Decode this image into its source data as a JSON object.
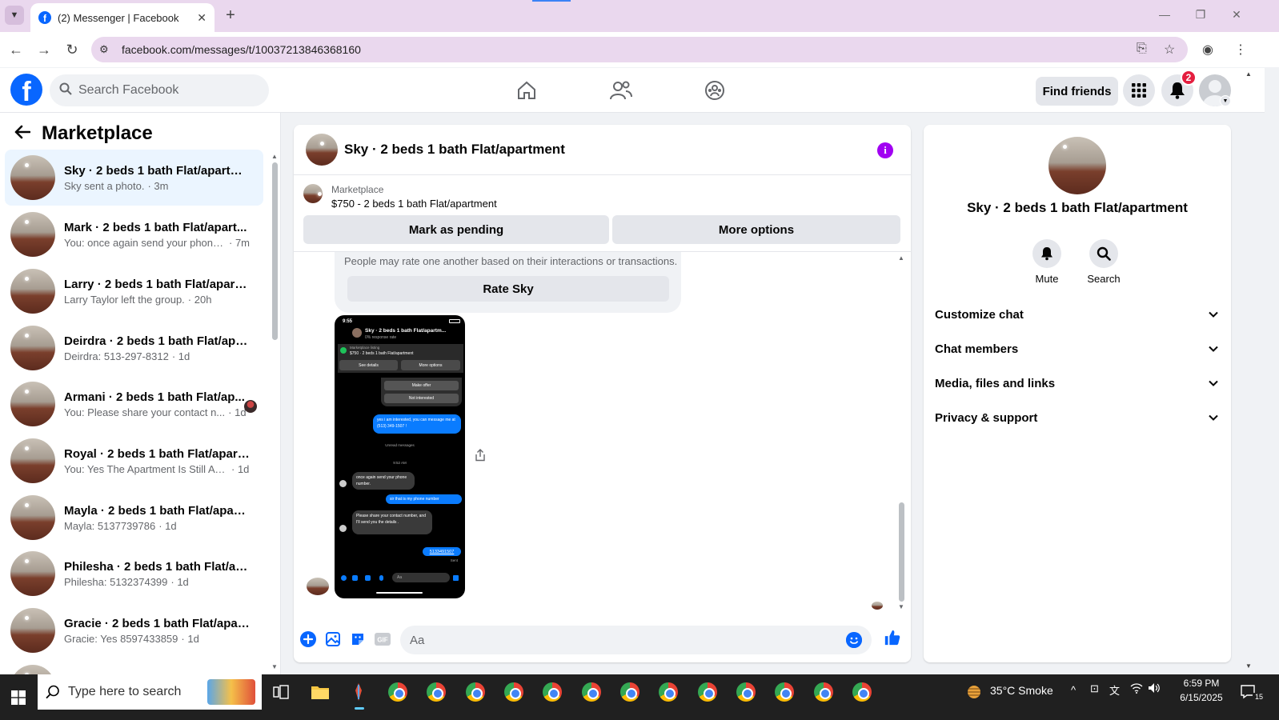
{
  "browser": {
    "tab_title": "(2) Messenger | Facebook",
    "url": "facebook.com/messages/t/10037213846368160"
  },
  "fb_header": {
    "search_placeholder": "Search Facebook",
    "find_friends_label": "Find friends",
    "notification_count": "2"
  },
  "sidebar": {
    "title": "Marketplace",
    "conversations": [
      {
        "name": "Sky · 2 beds 1 bath Flat/apartment",
        "preview": "Sky sent a photo.",
        "time": "· 3m",
        "active": true
      },
      {
        "name": "Mark · 2 beds 1 bath Flat/apart...",
        "preview": "You: once again send your phone ...",
        "time": "· 7m"
      },
      {
        "name": "Larry · 2 beds 1 bath Flat/apartm...",
        "preview": "Larry Taylor left the group.",
        "time": "· 20h"
      },
      {
        "name": "Deirdra · 2 beds 1 bath Flat/apar...",
        "preview": "Deirdra: 513-297-8312",
        "time": "· 1d"
      },
      {
        "name": "Armani · 2 beds 1 bath Flat/ap...",
        "preview": "You: Please share your contact n...",
        "time": "· 1d"
      },
      {
        "name": "Royal · 2 beds 1 bath Flat/apart...",
        "preview": "You: Yes The Apartment Is Still Avail...",
        "time": "· 1d"
      },
      {
        "name": "Mayla · 2 beds 1 bath Flat/apart...",
        "preview": "Mayla: 5137739786",
        "time": "· 1d"
      },
      {
        "name": "Philesha · 2 beds 1 bath Flat/apa...",
        "preview": "Philesha: 5132374399",
        "time": "· 1d"
      },
      {
        "name": "Gracie · 2 beds 1 bath Flat/apart...",
        "preview": "Gracie: Yes 8597433859",
        "time": "· 1d"
      }
    ]
  },
  "chat": {
    "title": "Sky · 2 beds 1 bath Flat/apartment",
    "marketplace_label": "Marketplace",
    "listing": "$750 - 2 beds 1 bath Flat/apartment",
    "mark_pending_label": "Mark as pending",
    "more_options_label": "More options",
    "rate_text": "People may rate one another based on their interactions or transactions.",
    "rate_button": "Rate Sky",
    "composer_placeholder": "Aa",
    "screenshot": {
      "time": "9:55",
      "title": "Sky · 2 beds 1 bath Flat/apartm...",
      "subtitle": "0% response rate",
      "mp_label": "Marketplace listing",
      "listing": "$750 · 2 beds 1 bath Flat/apartment",
      "see_details": "See details",
      "more_options": "More options",
      "make_offer": "Make offer",
      "not_interested": "Not interested",
      "msg1": "yes i am interested, you can message me at (513) 349-1507 !",
      "unread": "Unread messages",
      "time2": "9:52 AM",
      "msg2": "once again send your phone number.",
      "msg3": "sir that is my phone number",
      "msg4": "Please share your contact number, and I'll send you the details .",
      "msg5": "5133491507",
      "sent": "Sent",
      "input": "Aa"
    }
  },
  "info_panel": {
    "name": "Sky · 2 beds 1 bath Flat/apartment",
    "mute_label": "Mute",
    "search_label": "Search",
    "sections": [
      "Customize chat",
      "Chat members",
      "Media, files and links",
      "Privacy & support"
    ]
  },
  "taskbar": {
    "search_placeholder": "Type here to search",
    "weather": "35°C  Smoke",
    "time": "6:59 PM",
    "date": "6/15/2025",
    "notif_count": "15"
  },
  "colors": {
    "fb_blue": "#0866ff",
    "info_purple": "#a100f2",
    "badge_red": "#e41e3f",
    "active_row": "#ebf5ff"
  }
}
